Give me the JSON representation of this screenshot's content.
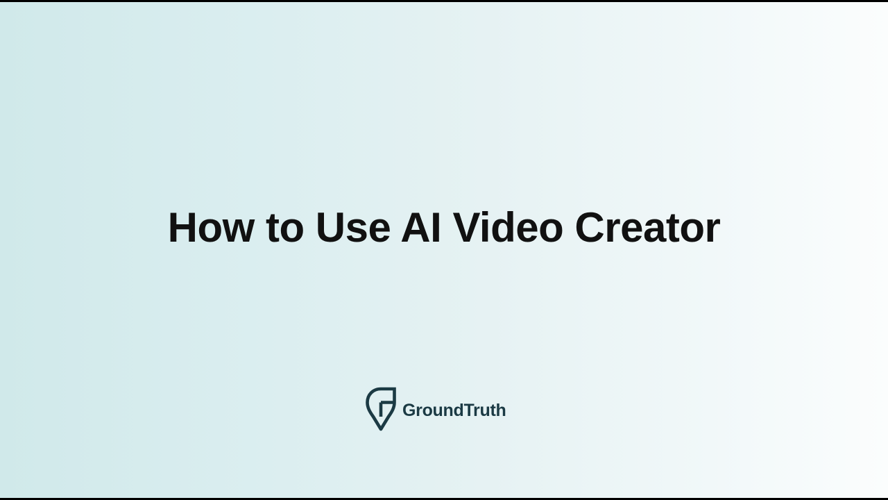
{
  "slide": {
    "title": "How to Use AI Video Creator"
  },
  "brand": {
    "name": "GroundTruth",
    "logo_icon": "map-pin-g-icon",
    "color": "#1b3a44"
  },
  "colors": {
    "title": "#111111",
    "background_left": "#d0e9ea",
    "background_right": "#fbfdfd",
    "letterbox": "#000000"
  }
}
